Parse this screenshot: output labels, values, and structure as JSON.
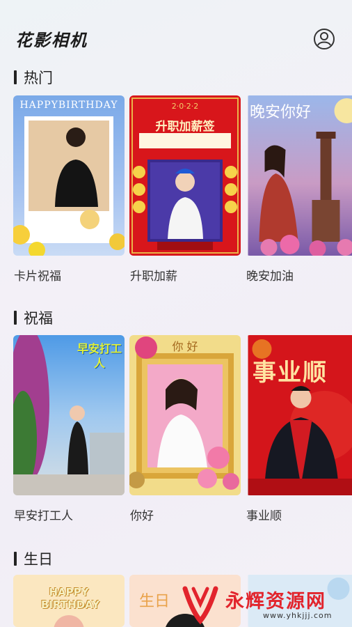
{
  "app": {
    "title": "花影相机"
  },
  "sections": [
    {
      "title": "热门",
      "items": [
        {
          "label": "卡片祝福",
          "thumb_text": "HAPPYBIRTHDAY"
        },
        {
          "label": "升职加薪",
          "thumb_text": "升职加薪签",
          "thumb_sub": "2·0·2·2"
        },
        {
          "label": "晚安加油",
          "thumb_text": "晚安你好"
        }
      ]
    },
    {
      "title": "祝福",
      "items": [
        {
          "label": "早安打工人",
          "thumb_text": "早安打工人"
        },
        {
          "label": "你好",
          "thumb_text": "你 好"
        },
        {
          "label": "事业顺",
          "thumb_text": "事业顺"
        }
      ]
    },
    {
      "title": "生日",
      "items": [
        {
          "label": "",
          "thumb_text": "HAPPY BIRTHDAY"
        },
        {
          "label": "",
          "thumb_text": "生日"
        },
        {
          "label": "",
          "thumb_text": ""
        }
      ]
    }
  ],
  "watermark": {
    "text": "永辉资源网",
    "url": "www.yhkjjj.com"
  },
  "colors": {
    "red": "#d8161b",
    "gold": "#e3b54c",
    "blue": "#6e8fd6"
  }
}
